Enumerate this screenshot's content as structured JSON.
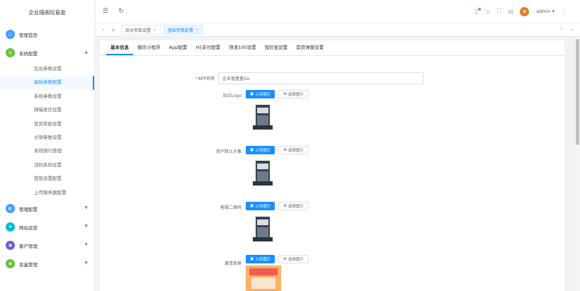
{
  "sidebar": {
    "logo": "企业插画玩盲盒",
    "items": [
      {
        "label": "管理首页",
        "color": "#409eff",
        "icon": "home-icon",
        "glyph": "○"
      },
      {
        "label": "系统配置",
        "color": "#67c23a",
        "icon": "gear-icon",
        "glyph": "◎",
        "expanded": true
      },
      {
        "label": "管理配置",
        "color": "#409eff",
        "icon": "manage-icon",
        "glyph": "◐"
      },
      {
        "label": "网站运营",
        "color": "#00bcd4",
        "icon": "star-icon",
        "glyph": "★"
      },
      {
        "label": "客户管理",
        "color": "#6f5ed1",
        "icon": "user-icon",
        "glyph": "◉"
      },
      {
        "label": "盲盒管理",
        "color": "#67c23a",
        "icon": "box-icon",
        "glyph": "◆"
      }
    ],
    "subitems": [
      "后台参数设置",
      "基础参数配置",
      "系统参数设置",
      "邮箱发信设置",
      "签到奖励设置",
      "分销参数设置",
      "系统银行管理",
      "活码系统设置",
      "提现设置配置",
      "上传服务器配置"
    ],
    "active_subitem": 1
  },
  "header": {
    "user": "admin ▾",
    "accent": "#1890ff"
  },
  "tags": [
    {
      "label": "后台参数设置",
      "active": false
    },
    {
      "label": "基础参数配置",
      "active": true
    }
  ],
  "tabs": [
    "基本信息",
    "微信小程序",
    "App配置",
    "H5支付配置",
    "快递100设置",
    "短信宝设置",
    "首页弹窗设置"
  ],
  "form": {
    "app_name_label": "APP名称",
    "app_name_value": "企业盲盒盒Go",
    "upload_label": "上传图片",
    "select_label": "选择图片",
    "fields": [
      {
        "label": "站点Logo"
      },
      {
        "label": "用户默认头像"
      },
      {
        "label": "客服二维码"
      },
      {
        "label": "邀请背景"
      }
    ]
  }
}
